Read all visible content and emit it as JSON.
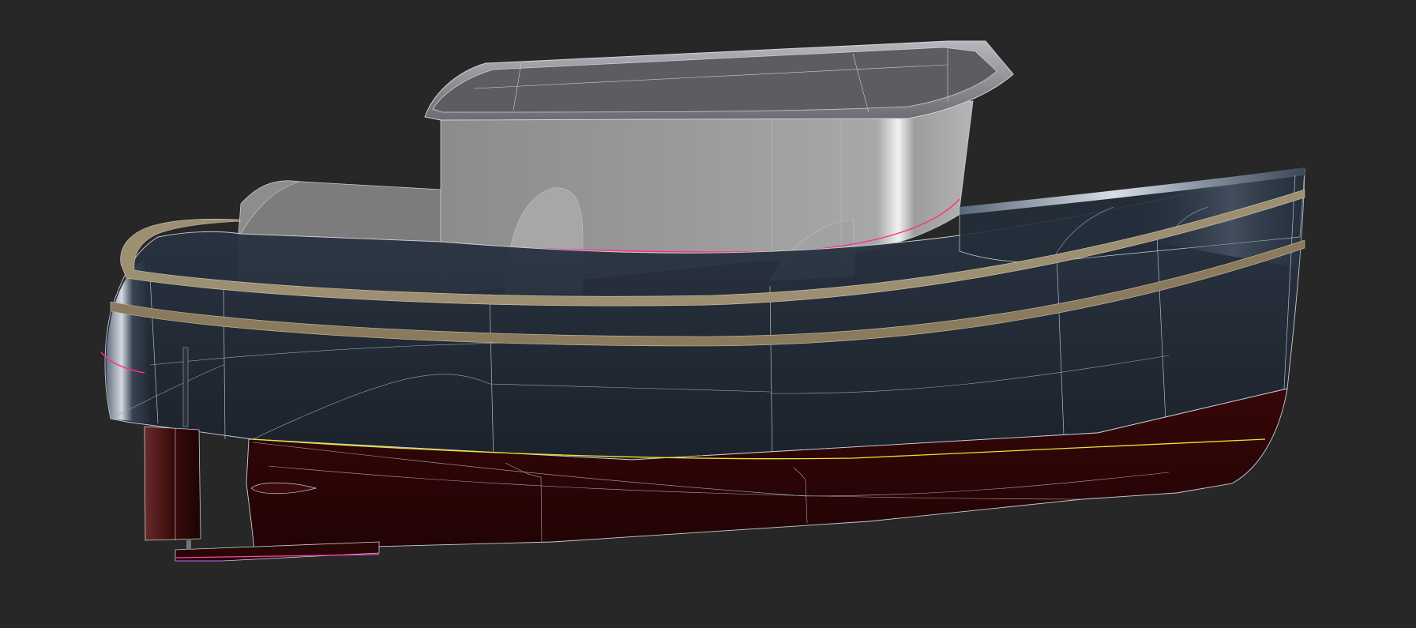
{
  "viewport": {
    "background_color": "#272727"
  },
  "model": {
    "colors": {
      "hull_upper": "#1e2733",
      "hull_bottom": "#2a0506",
      "cabin": "#a0a0a0",
      "roof": "#7a7780",
      "rub_rail": "#b8a98a",
      "edges": "#c9cdd4",
      "waterline": "#e6e62a",
      "sheer_curve": "#ff2d8a",
      "keel_curve": "#ff40c0"
    }
  }
}
